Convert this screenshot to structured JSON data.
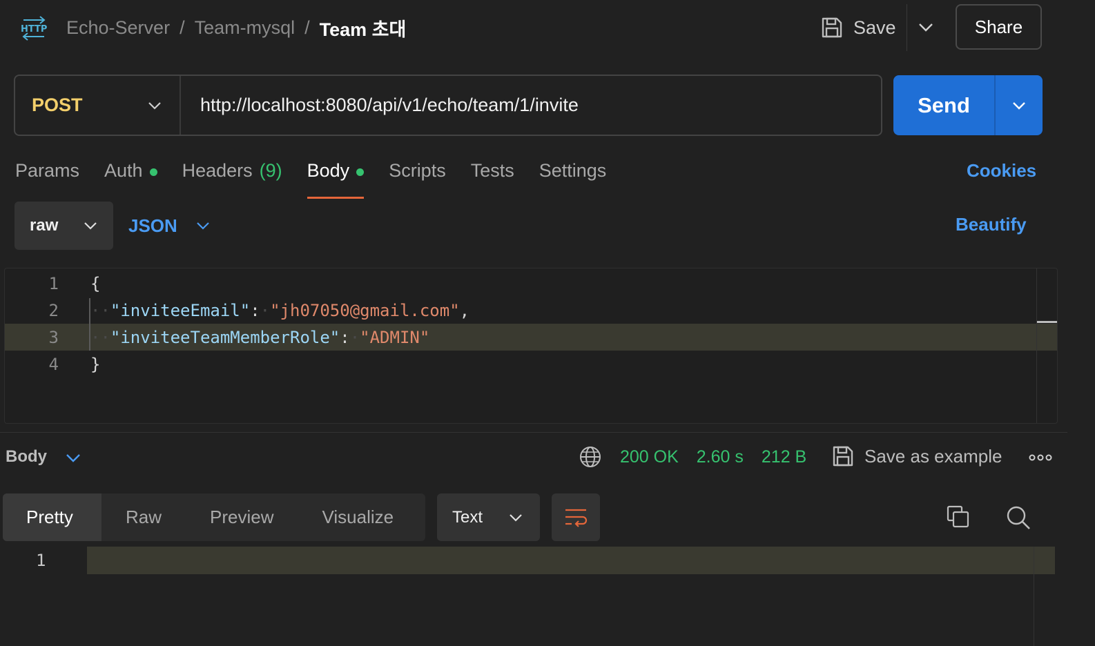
{
  "header": {
    "breadcrumb": [
      "Echo-Server",
      "Team-mysql"
    ],
    "separator": "/",
    "current": "Team 초대",
    "save_label": "Save",
    "share_label": "Share"
  },
  "request": {
    "method": "POST",
    "url": "http://localhost:8080/api/v1/echo/team/1/invite",
    "send_label": "Send"
  },
  "tabs": {
    "params": "Params",
    "auth": "Auth",
    "headers": "Headers",
    "headers_count": "(9)",
    "body": "Body",
    "scripts": "Scripts",
    "tests": "Tests",
    "settings": "Settings",
    "cookies": "Cookies"
  },
  "body_options": {
    "mode": "raw",
    "language": "JSON",
    "beautify": "Beautify"
  },
  "request_body": {
    "line_numbers": [
      "1",
      "2",
      "3",
      "4"
    ],
    "open_brace": "{",
    "close_brace": "}",
    "key1": "\"inviteeEmail\"",
    "value1": "\"jh07050@gmail.com\"",
    "key2": "\"inviteeTeamMemberRole\"",
    "value2": "\"ADMIN\""
  },
  "response": {
    "body_label": "Body",
    "status": "200 OK",
    "time": "2.60 s",
    "size": "212 B",
    "save_example": "Save as example",
    "tabs": [
      "Pretty",
      "Raw",
      "Preview",
      "Visualize"
    ],
    "format": "Text",
    "line_numbers": [
      "1"
    ]
  },
  "colors": {
    "accent_blue": "#1f6fd6",
    "link_blue": "#4a9bf3",
    "method_yellow": "#f3cf6b",
    "status_green": "#36c26f",
    "tab_underline": "#e5663a"
  }
}
